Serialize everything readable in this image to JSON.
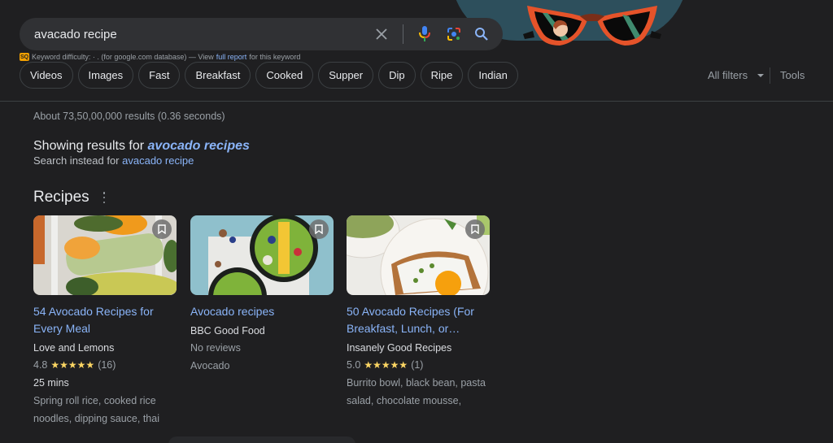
{
  "search": {
    "query": "avacado recipe",
    "icons": [
      "close-icon",
      "mic-icon",
      "lens-icon",
      "search-icon"
    ]
  },
  "keyword_bar": {
    "badge": "SQ",
    "prefix": "Keyword difficulty: · . (for google.com database) — View",
    "link": "full report",
    "suffix": "for this keyword"
  },
  "chips": [
    "Videos",
    "Images",
    "Fast",
    "Breakfast",
    "Cooked",
    "Supper",
    "Dip",
    "Ripe",
    "Indian"
  ],
  "filters": {
    "all_filters": "All filters",
    "tools": "Tools"
  },
  "stats": "About 73,50,00,000 results (0.36 seconds)",
  "correction": {
    "showing_prefix": "Showing results for",
    "showing_query": "avocado recipes",
    "instead_prefix": "Search instead for",
    "instead_query": "avacado recipe"
  },
  "recipes": {
    "title": "Recipes",
    "cards": [
      {
        "title_line1": "54 Avocado Recipes for",
        "title_line2": "Every Meal",
        "source": "Love and Lemons",
        "rating": "4.8",
        "stars": "★★★★★",
        "reviews": "(16)",
        "time": "25 mins",
        "desc_line1": "Spring roll rice, cooked rice",
        "desc_line2": "noodles, dipping sauce, thai"
      },
      {
        "title_line1": "Avocado recipes",
        "source": "BBC Good Food",
        "no_reviews": "No reviews",
        "category": "Avocado"
      },
      {
        "title_line1": "50 Avocado Recipes (For",
        "title_line2": "Breakfast, Lunch, or…",
        "source": "Insanely Good Recipes",
        "rating": "5.0",
        "stars": "★★★★★",
        "reviews": "(1)",
        "desc_line1": "Burrito bowl, black bean, pasta",
        "desc_line2": "salad, chocolate mousse,"
      }
    ]
  },
  "colors": {
    "background": "#1f1f21",
    "link": "#8ab4f8",
    "star": "#fdd663"
  }
}
